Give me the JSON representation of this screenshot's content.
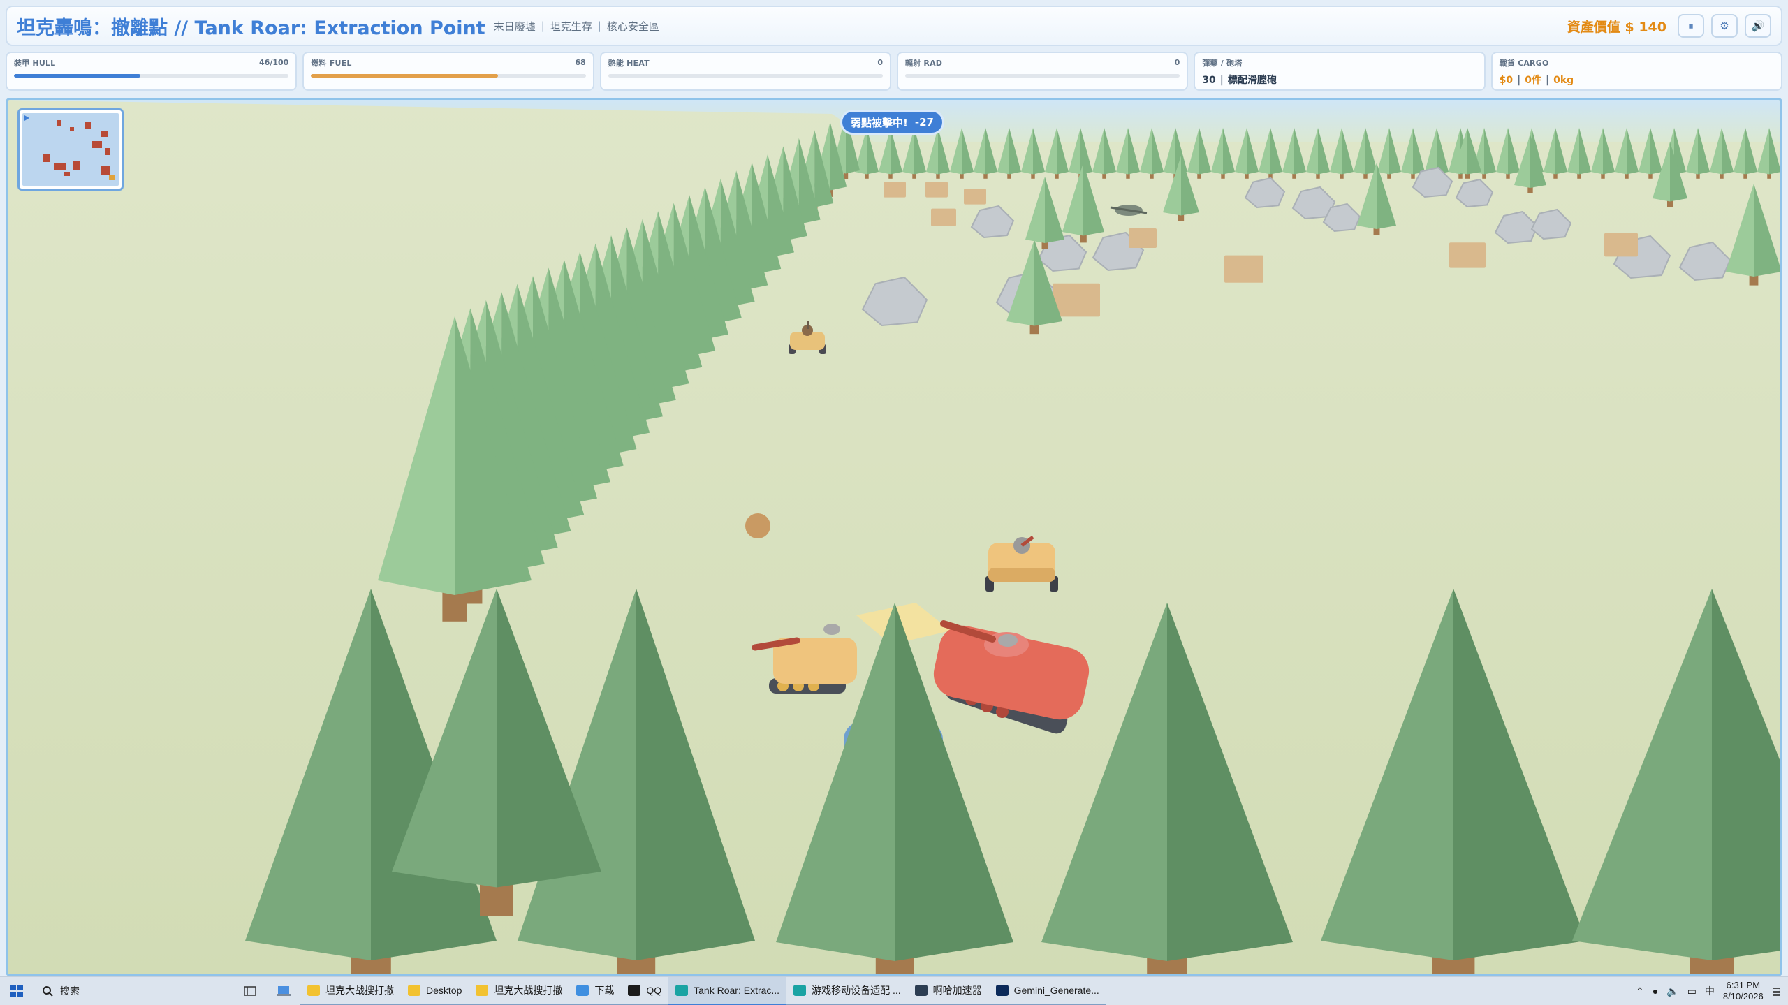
{
  "header": {
    "title": "坦克轟鳴：撤離點 // Tank Roar: Extraction Point",
    "tags": [
      "末日廢墟",
      "坦克生存",
      "核心安全區"
    ],
    "asset_value": "資產價值 $ 140",
    "buttons": [
      {
        "name": "pause-button",
        "glyph": "⏸"
      },
      {
        "name": "settings-button",
        "glyph": "⚙"
      },
      {
        "name": "sound-button",
        "glyph": "🔊"
      }
    ]
  },
  "stats": {
    "hull": {
      "label": "裝甲 HULL",
      "value": "46/100",
      "fraction": 0.46,
      "color": "#3f7fd6"
    },
    "fuel": {
      "label": "燃料 FUEL",
      "value": "68",
      "fraction": 0.68,
      "color": "#e3a04a"
    },
    "heat": {
      "label": "熱能 HEAT",
      "value": "0",
      "fraction": 0,
      "color": "#e05a4a"
    },
    "rad": {
      "label": "輻射 RAD",
      "value": "0",
      "fraction": 0,
      "color": "#6bbf59"
    },
    "ammo": {
      "label": "彈藥 / 砲塔",
      "count": "30",
      "weapon": "標配滑膛砲"
    },
    "cargo": {
      "label": "戰貨 CARGO",
      "money": "$0",
      "items": "0件",
      "weight": "0kg"
    }
  },
  "game": {
    "alert_text": "弱點被擊中!",
    "alert_value": "-27"
  },
  "taskbar": {
    "search_label": "搜索",
    "apps": [
      {
        "name": "taskbar-app-explorer-1",
        "label": "坦克大战搜打撤",
        "icon_color": "#f2c230",
        "state": "open"
      },
      {
        "name": "taskbar-app-desktop",
        "label": "Desktop",
        "icon_color": "#f2c230",
        "state": "open"
      },
      {
        "name": "taskbar-app-explorer-2",
        "label": "坦克大战搜打撤",
        "icon_color": "#f2c230",
        "state": "open"
      },
      {
        "name": "taskbar-app-downloads",
        "label": "下载",
        "icon_color": "#3f8fe0",
        "state": "open"
      },
      {
        "name": "taskbar-app-qq",
        "label": "QQ",
        "icon_color": "#1b1b1b",
        "state": "open"
      },
      {
        "name": "taskbar-app-edge-game",
        "label": "Tank Roar: Extrac...",
        "icon_color": "#1aa3a3",
        "state": "active"
      },
      {
        "name": "taskbar-app-edge-2",
        "label": "游戏移动设备适配 ...",
        "icon_color": "#1aa3a3",
        "state": "open"
      },
      {
        "name": "taskbar-app-accelerator",
        "label": "啊哈加速器",
        "icon_color": "#2c3d52",
        "state": "open"
      },
      {
        "name": "taskbar-app-photoshop",
        "label": "Gemini_Generate...",
        "icon_color": "#0b2a5a",
        "state": "open"
      }
    ],
    "time": "6:31 PM",
    "date": "8/10/2026"
  }
}
